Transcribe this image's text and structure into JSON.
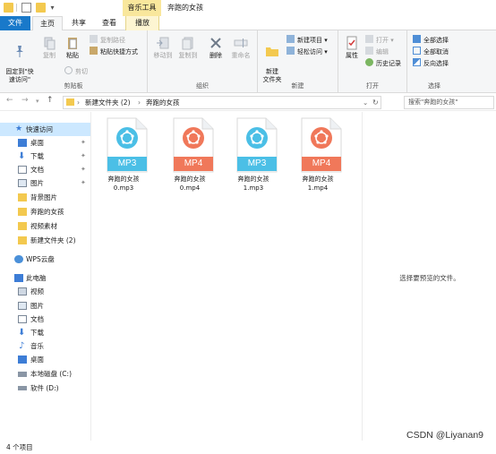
{
  "window": {
    "context_tab": "音乐工具",
    "title": "奔跑的女孩"
  },
  "ribbon_tabs": {
    "file": "文件",
    "home": "主页",
    "share": "共享",
    "view": "查看",
    "play": "播放"
  },
  "ribbon": {
    "clipboard": {
      "pin": "固定到\"快\n速访问\"",
      "copy": "复制",
      "paste": "粘贴",
      "copy_path": "复制路径",
      "paste_shortcut": "粘贴快捷方式",
      "cut": "剪切",
      "label": "剪贴板"
    },
    "organize": {
      "move_to": "移动到",
      "copy_to": "复制到",
      "delete": "删除",
      "rename": "重命名",
      "label": "组织"
    },
    "new": {
      "new_folder": "新建\n文件夹",
      "new_item": "新建项目",
      "easy_access": "轻松访问",
      "label": "新建"
    },
    "open": {
      "properties": "属性",
      "open": "打开",
      "edit": "编辑",
      "history": "历史记录",
      "label": "打开"
    },
    "select": {
      "select_all": "全部选择",
      "select_none": "全部取消",
      "invert": "反向选择",
      "label": "选择"
    }
  },
  "address": {
    "crumbs": [
      "新建文件夹 (2)",
      "奔跑的女孩"
    ],
    "search_placeholder": "搜索\"奔跑的女孩\""
  },
  "nav_pane": {
    "quick_access": "快速访问",
    "items": [
      "桌面",
      "下载",
      "文档",
      "图片",
      "背景图片",
      "奔跑的女孩",
      "视频素材",
      "新建文件夹 (2)"
    ],
    "wps": "WPS云盘",
    "this_pc": "此电脑",
    "pc_items": [
      "视频",
      "图片",
      "文档",
      "下载",
      "音乐",
      "桌面",
      "本地磁盘 (C:)",
      "软件 (D:)"
    ]
  },
  "files": [
    {
      "name_line1": "奔跑的女孩",
      "name_line2": "0.mp3",
      "badge": "MP3",
      "color": "#4bbfe6"
    },
    {
      "name_line1": "奔跑的女孩",
      "name_line2": "0.mp4",
      "badge": "MP4",
      "color": "#f0785a"
    },
    {
      "name_line1": "奔跑的女孩",
      "name_line2": "1.mp3",
      "badge": "MP3",
      "color": "#4bbfe6"
    },
    {
      "name_line1": "奔跑的女孩",
      "name_line2": "1.mp4",
      "badge": "MP4",
      "color": "#f0785a"
    }
  ],
  "preview_text": "选择要预览的文件。",
  "status": {
    "count": "4 个项目",
    "watermark": "CSDN @Liyanan9"
  },
  "colors": {
    "accent": "#1979ca",
    "ctx_tab": "#f9e79c",
    "selected": "#cce8ff"
  }
}
